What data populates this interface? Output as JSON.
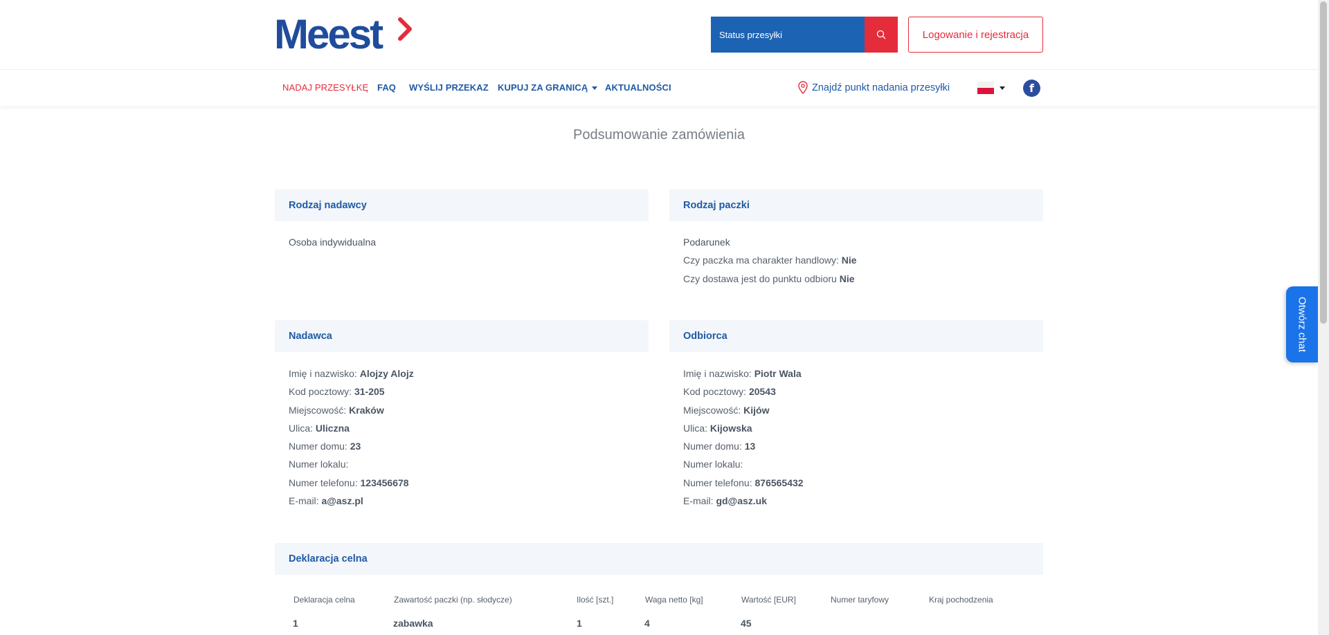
{
  "header": {
    "logo_text": "Meest",
    "search": {
      "placeholder": "Status przesyłki"
    },
    "login_label": "Logowanie i rejestracja"
  },
  "nav": {
    "items": [
      {
        "label": "NADAJ PRZESYŁKĘ",
        "active": true
      },
      {
        "label": "FAQ"
      },
      {
        "label": "WYŚLIJ PRZEKAZ"
      },
      {
        "label": "KUPUJ ZA GRANICĄ",
        "dropdown": true
      },
      {
        "label": "AKTUALNOŚCI"
      }
    ],
    "find_point": "Znajdź punkt nadania przesyłki",
    "facebook_icon": "f"
  },
  "main": {
    "title": "Podsumowanie zamówienia",
    "sender_type": {
      "heading": "Rodzaj nadawcy",
      "value": "Osoba indywidualna"
    },
    "package_type": {
      "heading": "Rodzaj paczki",
      "value": "Podarunek",
      "commercial_label": "Czy paczka ma charakter handlowy:",
      "commercial_value": "Nie",
      "pickup_label": "Czy dostawa jest do punktu odbioru",
      "pickup_value": "Nie"
    },
    "sender": {
      "heading": "Nadawca",
      "fields": [
        {
          "label": "Imię i nazwisko:",
          "value": "Alojzy Alojz"
        },
        {
          "label": "Kod pocztowy:",
          "value": "31-205"
        },
        {
          "label": "Miejscowość:",
          "value": "Kraków"
        },
        {
          "label": "Ulica:",
          "value": "Uliczna"
        },
        {
          "label": "Numer domu:",
          "value": "23"
        },
        {
          "label": "Numer lokalu:",
          "value": ""
        },
        {
          "label": "Numer telefonu:",
          "value": "123456678"
        },
        {
          "label": "E-mail:",
          "value": "a@asz.pl"
        }
      ]
    },
    "recipient": {
      "heading": "Odbiorca",
      "fields": [
        {
          "label": "Imię i nazwisko:",
          "value": "Piotr Wala"
        },
        {
          "label": "Kod pocztowy:",
          "value": "20543"
        },
        {
          "label": "Miejscowość:",
          "value": "Kijów"
        },
        {
          "label": "Ulica:",
          "value": "Kijowska"
        },
        {
          "label": "Numer domu:",
          "value": "13"
        },
        {
          "label": "Numer lokalu:",
          "value": ""
        },
        {
          "label": "Numer telefonu:",
          "value": "876565432"
        },
        {
          "label": "E-mail:",
          "value": "gd@asz.uk"
        }
      ]
    },
    "customs": {
      "heading": "Deklaracja celna",
      "columns": [
        "Deklaracja celna",
        "Zawartość paczki (np. słodycze)",
        "Ilość [szt.]",
        "Waga netto [kg]",
        "Wartość [EUR]",
        "Numer taryfowy",
        "Kraj pochodzenia"
      ],
      "rows": [
        [
          "1",
          "zabawka",
          "1",
          "4",
          "45",
          "",
          ""
        ]
      ]
    }
  },
  "chat": {
    "label": "Otwórz chat"
  },
  "colors": {
    "brand_blue": "#1f5aa6",
    "brand_red": "#e42c3b",
    "search_blue": "#1c63b3",
    "chat_blue": "#1a73e8"
  }
}
